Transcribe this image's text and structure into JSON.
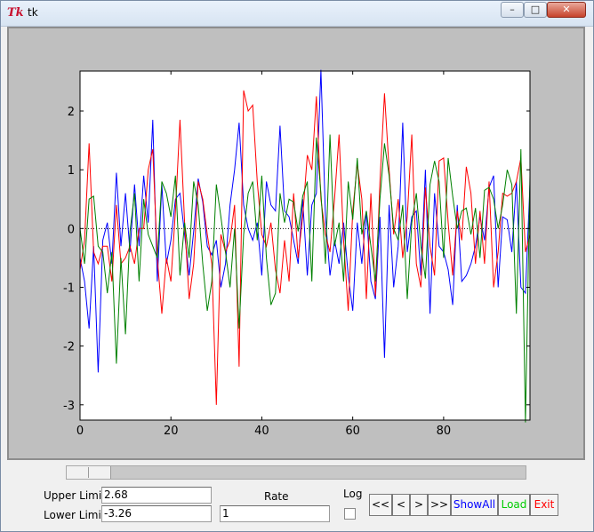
{
  "window": {
    "title": "tk",
    "app_icon_glyph": "Tk",
    "controls": {
      "minimize": "–",
      "maximize": "□",
      "close": "✕"
    }
  },
  "chart_data": {
    "type": "line",
    "xlim": [
      0,
      99
    ],
    "ylim": [
      -3.26,
      2.68
    ],
    "xticks": [
      0,
      20,
      40,
      60,
      80
    ],
    "yticks": [
      -3,
      -2,
      -1,
      0,
      1,
      2
    ],
    "grid": false,
    "reference_line": {
      "y": 0,
      "style": "dotted",
      "color": "#000000"
    },
    "series": [
      {
        "color": "#0000ff",
        "values": [
          -0.5,
          -0.9,
          -1.7,
          -0.3,
          -2.45,
          -0.2,
          0.1,
          -0.6,
          0.95,
          -0.3,
          0.6,
          -0.4,
          0.75,
          -0.3,
          0.9,
          0.1,
          1.85,
          -0.9,
          0.75,
          -0.6,
          -0.2,
          0.5,
          0.6,
          -0.1,
          -0.8,
          -0.05,
          0.85,
          0.45,
          -0.3,
          -0.45,
          -0.2,
          -1.0,
          -0.6,
          0.4,
          1.0,
          1.8,
          0.4,
          0.0,
          -0.2,
          0.1,
          -0.8,
          0.8,
          0.4,
          0.3,
          1.75,
          0.3,
          0.2,
          -0.2,
          -0.6,
          0.5,
          -0.8,
          0.4,
          0.6,
          2.7,
          0.2,
          -0.8,
          -0.2,
          -0.6,
          0.1,
          -0.8,
          -1.4,
          0.1,
          -0.6,
          0.3,
          -0.9,
          -1.2,
          0.2,
          -2.2,
          0.4,
          -1.0,
          -0.3,
          1.8,
          -0.4,
          0.2,
          0.3,
          -0.8,
          1.0,
          -1.45,
          0.6,
          -0.3,
          -0.4,
          -0.7,
          -1.3,
          0.4,
          -0.9,
          -0.8,
          -0.6,
          -0.3,
          0.2,
          -0.2,
          0.7,
          0.9,
          -1.0,
          0.2,
          0.15,
          -0.4,
          0.8,
          -1.0,
          -1.1,
          0.75
        ]
      },
      {
        "color": "#ff0000",
        "values": [
          -0.7,
          -0.2,
          1.45,
          -0.4,
          -0.6,
          -0.3,
          -0.3,
          -0.9,
          0.4,
          -0.6,
          -0.5,
          -0.3,
          -0.6,
          0.0,
          0.0,
          1.0,
          1.35,
          -0.5,
          -1.45,
          -0.5,
          -0.9,
          0.3,
          1.85,
          0.1,
          -1.2,
          -0.6,
          0.8,
          0.5,
          -0.1,
          -0.6,
          -3.0,
          -0.1,
          -0.4,
          -0.2,
          0.4,
          -2.35,
          2.35,
          2.0,
          2.1,
          0.8,
          -0.1,
          -0.3,
          0.1,
          -0.7,
          -1.1,
          -0.2,
          -0.9,
          0.6,
          -0.5,
          0.2,
          1.25,
          1.0,
          2.25,
          0.5,
          -0.1,
          -0.4,
          0.5,
          1.6,
          -0.2,
          -1.4,
          0.3,
          1.1,
          0.5,
          -1.2,
          0.6,
          -1.15,
          0.8,
          2.3,
          1.0,
          -0.1,
          0.5,
          -0.5,
          0.2,
          1.6,
          -0.6,
          -1.0,
          0.7,
          -0.3,
          -0.8,
          1.15,
          1.2,
          0.1,
          -0.8,
          0.3,
          -0.2,
          1.05,
          0.6,
          -0.6,
          0.3,
          -0.6,
          0.8,
          -1.0,
          -0.4,
          0.6,
          0.55,
          0.6,
          0.8,
          1.2,
          -0.4,
          -0.1
        ]
      },
      {
        "color": "#008000",
        "values": [
          0.0,
          -0.6,
          0.5,
          0.55,
          -0.3,
          -0.4,
          -1.1,
          -0.4,
          -2.3,
          -0.5,
          -1.8,
          -0.05,
          0.6,
          -0.9,
          0.5,
          -0.1,
          -0.3,
          -0.5,
          0.8,
          0.6,
          0.2,
          0.9,
          -0.8,
          0.1,
          -0.5,
          0.8,
          0.4,
          -0.6,
          -1.4,
          -0.9,
          0.75,
          0.2,
          -0.4,
          -1.0,
          0.0,
          -1.7,
          -0.1,
          0.6,
          0.8,
          -0.2,
          0.9,
          -0.5,
          -1.3,
          -1.1,
          0.6,
          0.1,
          0.5,
          0.45,
          -0.05,
          0.55,
          0.8,
          -0.9,
          1.55,
          0.6,
          -0.6,
          1.6,
          -0.3,
          0.1,
          -0.9,
          0.8,
          0.15,
          1.2,
          -0.1,
          0.3,
          -0.3,
          -0.9,
          0.5,
          1.45,
          0.9,
          0.0,
          -0.2,
          0.4,
          -1.2,
          0.1,
          0.6,
          -0.3,
          -0.85,
          0.75,
          1.15,
          0.8,
          -0.5,
          1.2,
          0.55,
          0.0,
          0.3,
          0.35,
          -0.1,
          0.35,
          -0.5,
          0.65,
          0.7,
          0.5,
          0.0,
          0.4,
          1.0,
          0.75,
          -1.45,
          1.35,
          -3.3,
          0.9
        ]
      }
    ]
  },
  "controls": {
    "upper_limit_label": "Upper Limit",
    "upper_limit_value": "2.68",
    "lower_limit_label": "Lower Limit",
    "lower_limit_value": "-3.26",
    "rate_label": "Rate",
    "rate_value": "1",
    "log_label": "Log",
    "log_checked": false,
    "buttons": {
      "first": "<<",
      "prev": "<",
      "next": ">",
      "last": ">>",
      "show_all": "ShowAll",
      "load": "Load",
      "exit": "Exit"
    },
    "colors": {
      "show_all": "#0000ff",
      "load": "#00cc00",
      "exit": "#ff0000"
    }
  },
  "scrollbar": {
    "position_fraction": 0.0
  }
}
